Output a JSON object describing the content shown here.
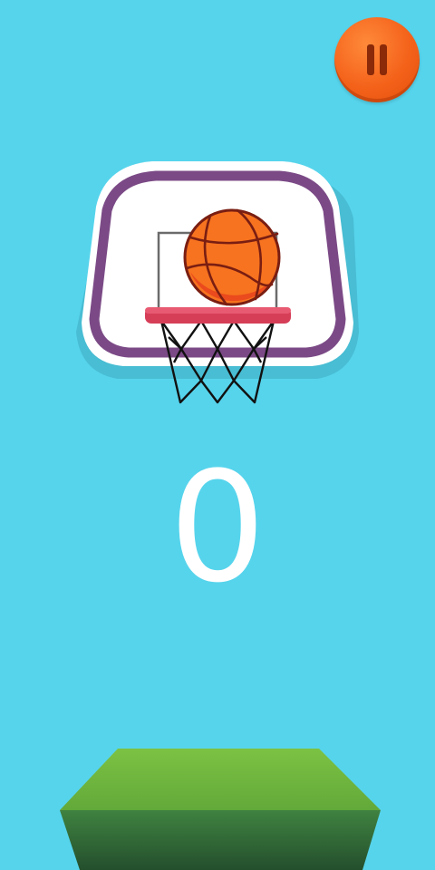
{
  "hud": {
    "pause_icon": "pause-icon",
    "pause_color": "#f4621a"
  },
  "score": {
    "value": "0"
  },
  "colors": {
    "background": "#56d4ec",
    "backboard_border": "#7b4a86",
    "backboard_fill": "#ffffff",
    "rim": "#e0455e",
    "ball": "#f7731f",
    "ground_top": "#7cc243",
    "ground_side": "#2f6a39"
  },
  "icons": [
    "pause-icon",
    "basketball-icon",
    "hoop-icon",
    "net-icon"
  ]
}
